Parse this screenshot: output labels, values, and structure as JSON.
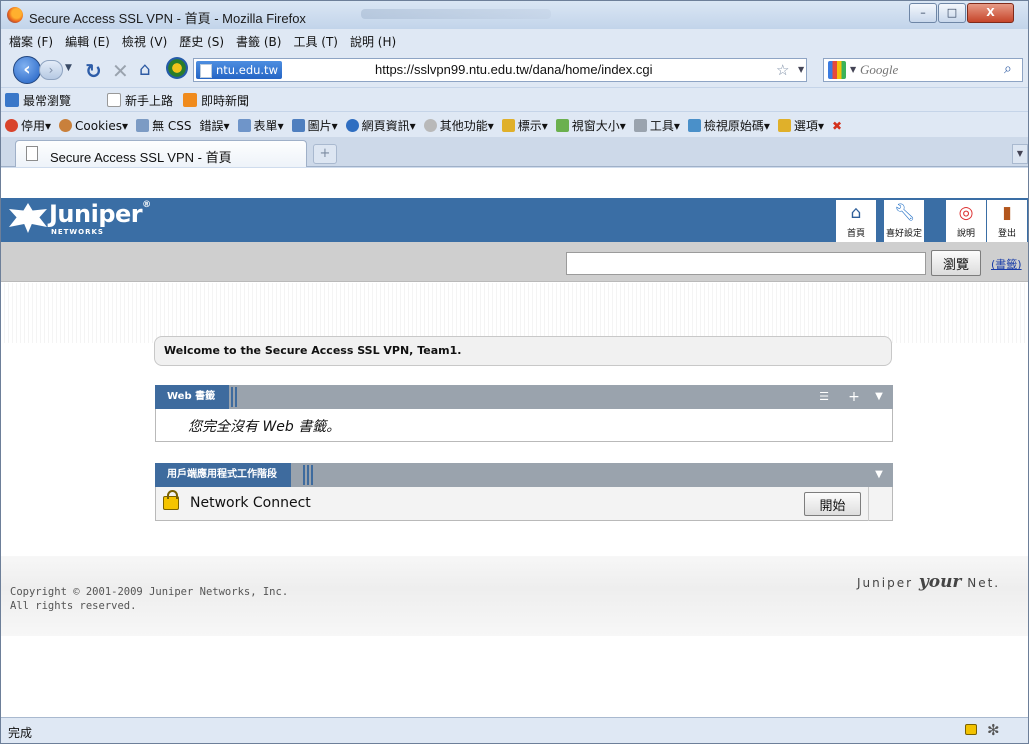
{
  "window": {
    "title": "Secure Access SSL VPN - 首頁 - Mozilla Firefox",
    "minimize": "–",
    "maximize": "□",
    "close": "X"
  },
  "menubar": {
    "items": [
      "檔案 (F)",
      "編輯 (E)",
      "檢視 (V)",
      "歷史 (S)",
      "書籤 (B)",
      "工具 (T)",
      "說明 (H)"
    ]
  },
  "navbar": {
    "site_identity": "ntu.edu.tw",
    "url": "https://sslvpn99.ntu.edu.tw/dana/home/index.cgi",
    "search_placeholder": "Google",
    "icons": [
      "back-icon",
      "forward-icon",
      "reload-icon",
      "stop-icon",
      "home-icon",
      "bookmark-star-icon",
      "search-go-icon"
    ]
  },
  "bookmarks": {
    "items": [
      "最常瀏覽",
      "新手上路",
      "即時新聞"
    ]
  },
  "devtoolbar": {
    "items": [
      "停用",
      "Cookies",
      "無 CSS",
      "錯誤",
      "表單",
      "圖片",
      "網頁資訊",
      "其他功能",
      "標示",
      "視窗大小",
      "工具",
      "檢視原始碼",
      "選項"
    ]
  },
  "tabs": {
    "active_label": "Secure Access SSL VPN - 首頁",
    "new_tab": "+"
  },
  "juniper": {
    "logo_word": "Juniper",
    "logo_sub": "NETWORKS",
    "nav": {
      "home": "首頁",
      "preferences": "喜好設定",
      "help": "說明",
      "signout": "登出"
    },
    "browse_button": "瀏覽",
    "bookmark_link": "(書籤)",
    "welcome": "Welcome to the Secure Access SSL VPN, Team1.",
    "web_panel": {
      "title": "Web 書籤",
      "empty_text": "您完全沒有 Web 書籤。"
    },
    "apps_panel": {
      "title": "用戶端應用程式工作階段",
      "app_name": "Network Connect",
      "start_button": "開始"
    },
    "copyright_line1": "Copyright © 2001-2009 Juniper Networks, Inc.",
    "copyright_line2": "All rights reserved.",
    "tagline_left": "Juniper",
    "tagline_your": "your",
    "tagline_right": "Net."
  },
  "statusbar": {
    "text": "完成"
  },
  "colors": {
    "juniper_blue": "#3a6ea5",
    "panel_header": "#3e6b9e",
    "panel_bar": "#9aa3ad"
  }
}
